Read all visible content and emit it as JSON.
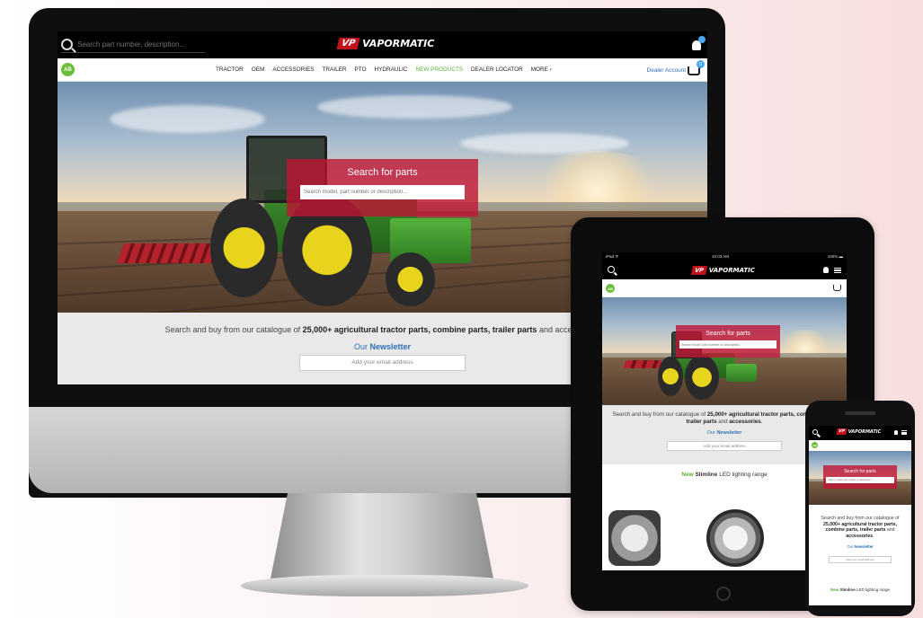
{
  "brand": {
    "logo_mark": "VP",
    "logo_name": "VAPORMATIC"
  },
  "search": {
    "placeholder": "Search part number, description..."
  },
  "badge": "AB",
  "nav": {
    "items": [
      "TRACTOR",
      "OEM",
      "ACCESSORIES",
      "TRAILER",
      "PTO",
      "HYDRAULIC",
      "NEW PRODUCTS",
      "DEALER LOCATOR",
      "MORE ›"
    ],
    "highlight_index": 6,
    "dealer_account": "Dealer Account",
    "cart_count": "0"
  },
  "hero": {
    "title": "Search for parts",
    "placeholder": "Search model, part number or description..."
  },
  "info": {
    "lead": "Search and buy from our catalogue of ",
    "strong": "25,000+ agricultural tractor parts, combine parts, trailer parts",
    "and": " and ",
    "tail": "accessories",
    "period": ".",
    "newsletter_our": "Our ",
    "newsletter": "Newsletter",
    "email_placeholder": "Add your email address"
  },
  "lighting": {
    "new": "New",
    "slimline": "Slimline",
    "rest": " LED lighting range"
  },
  "ipad_status": {
    "left": "iPad ᯤ",
    "time": "10:03 AM",
    "battery": "100% ▬"
  },
  "colors": {
    "brand_red": "#c0121c",
    "hero_box": "#be1434",
    "accent_green": "#5bb33a",
    "link_blue": "#2f6fb8",
    "badge_blue": "#49a7f0"
  }
}
